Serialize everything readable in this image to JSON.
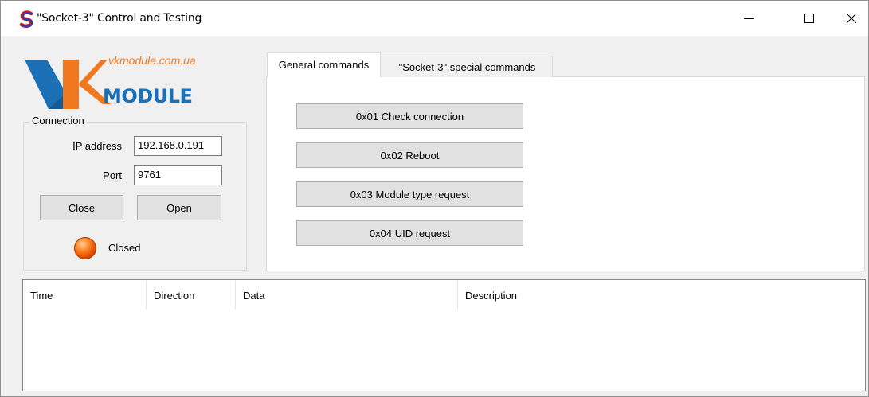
{
  "window": {
    "title": "\"Socket-3\" Control and Testing",
    "icon": "socket-app-icon",
    "controls": [
      "minimize-icon",
      "maximize-icon",
      "close-icon"
    ]
  },
  "logo": {
    "url_text": "vkmodule.com.ua",
    "brand_text": "MODULE",
    "colors": {
      "blue": "#1a6fb5",
      "orange": "#f07920"
    }
  },
  "connection": {
    "group_label": "Connection",
    "ip_label": "IP address",
    "ip_value": "192.168.0.191",
    "port_label": "Port",
    "port_value": "9761",
    "close_button": "Close",
    "open_button": "Open",
    "status": "Closed",
    "status_color": "#ff6a00"
  },
  "tabs": [
    {
      "label": "General commands",
      "active": true
    },
    {
      "label": "\"Socket-3\" special commands",
      "active": false
    }
  ],
  "commands": [
    "0x01 Check connection",
    "0x02 Reboot",
    "0x03 Module type request",
    "0x04 UID request"
  ],
  "log": {
    "columns": [
      "Time",
      "Direction",
      "Data",
      "Description"
    ],
    "rows": []
  }
}
